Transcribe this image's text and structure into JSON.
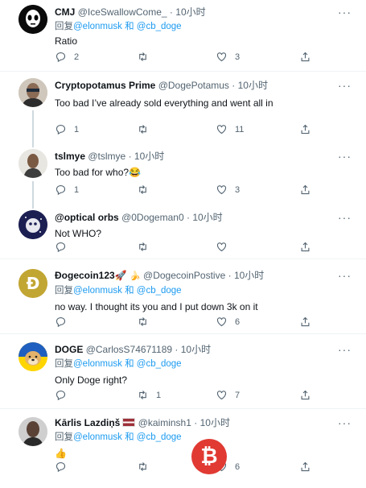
{
  "tweets": [
    {
      "name": "CMJ",
      "handle": "@IceSwallowCome_",
      "dot": "·",
      "time": "10小时",
      "reply_prefix": "回复",
      "reply_mentions": "@elonmusk 和 @cb_doge",
      "text": "Ratio",
      "replies": "2",
      "retweets": "",
      "likes": "3"
    },
    {
      "name": "Cryptopotamus Prime",
      "handle": "@DogePotamus",
      "dot": "·",
      "time": "10小时",
      "reply_prefix": "",
      "reply_mentions": "",
      "text": "Too bad I’ve already sold everything and went all in",
      "replies": "1",
      "retweets": "",
      "likes": "11"
    },
    {
      "name": "tslmye",
      "handle": "@tslmye",
      "dot": "·",
      "time": "10小时",
      "reply_prefix": "",
      "reply_mentions": "",
      "text": "Too bad for who?😂",
      "replies": "1",
      "retweets": "",
      "likes": "3"
    },
    {
      "name": "@optical orbs",
      "handle": "@0Dogeman0",
      "dot": "·",
      "time": "10小时",
      "reply_prefix": "",
      "reply_mentions": "",
      "text": "Not WHO?",
      "replies": "",
      "retweets": "",
      "likes": ""
    },
    {
      "name": "Ðogecoin123🚀",
      "name_badge": "🍌",
      "handle": "@DogecoinPostive",
      "dot": "·",
      "time": "10小时",
      "reply_prefix": "回复",
      "reply_mentions": "@elonmusk 和 @cb_doge",
      "text": "no way. I thought its you and I put down 3k on it",
      "replies": "",
      "retweets": "",
      "likes": "6"
    },
    {
      "name": "DOGE",
      "handle": "@CarlosS74671189",
      "dot": "·",
      "time": "10小时",
      "reply_prefix": "回复",
      "reply_mentions": "@elonmusk 和 @cb_doge",
      "text": "Only Doge right?",
      "replies": "",
      "retweets": "1",
      "likes": "7"
    },
    {
      "name": "Kārlis Lazdiņš",
      "handle": "@kaiminsh1",
      "dot": "·",
      "time": "10小时",
      "reply_prefix": "回复",
      "reply_mentions": "@elonmusk 和 @cb_doge",
      "text": "👍",
      "replies": "",
      "retweets": "",
      "likes": "6"
    }
  ],
  "more_label": "···",
  "watermark": "₿",
  "colors": {
    "accent": "#1d9bf0",
    "muted": "#536471",
    "divider": "#eff3f4",
    "watermark": "#e03a33"
  }
}
